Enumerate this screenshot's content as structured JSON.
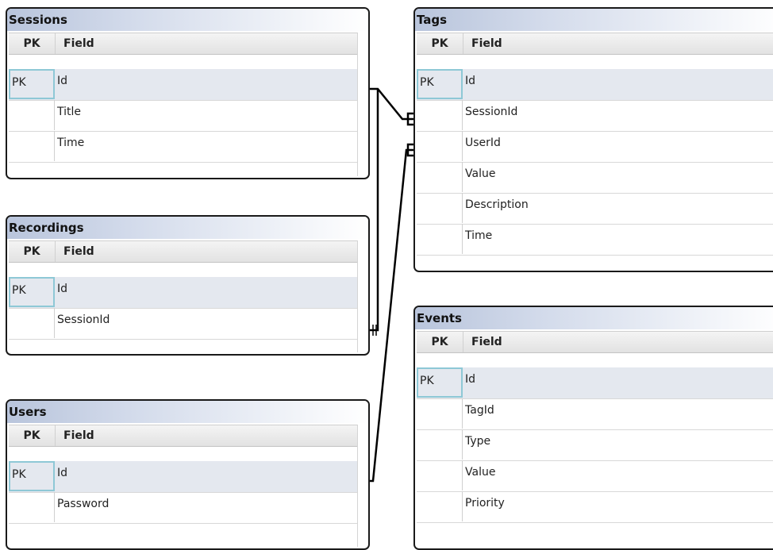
{
  "tables": {
    "sessions": {
      "name": "Sessions",
      "col_pk": "PK",
      "col_field": "Field",
      "rows": [
        {
          "pk": "PK",
          "field": "Id"
        },
        {
          "pk": "",
          "field": "Title"
        },
        {
          "pk": "",
          "field": "Time"
        }
      ]
    },
    "recordings": {
      "name": "Recordings",
      "col_pk": "PK",
      "col_field": "Field",
      "rows": [
        {
          "pk": "PK",
          "field": "Id"
        },
        {
          "pk": "",
          "field": "SessionId"
        }
      ]
    },
    "users": {
      "name": "Users",
      "col_pk": "PK",
      "col_field": "Field",
      "rows": [
        {
          "pk": "PK",
          "field": "Id"
        },
        {
          "pk": "",
          "field": "Password"
        }
      ]
    },
    "tags": {
      "name": "Tags",
      "col_pk": "PK",
      "col_field": "Field",
      "rows": [
        {
          "pk": "PK",
          "field": "Id"
        },
        {
          "pk": "",
          "field": "SessionId"
        },
        {
          "pk": "",
          "field": "UserId"
        },
        {
          "pk": "",
          "field": "Value"
        },
        {
          "pk": "",
          "field": "Description"
        },
        {
          "pk": "",
          "field": "Time"
        }
      ]
    },
    "events": {
      "name": "Events",
      "col_pk": "PK",
      "col_field": "Field",
      "rows": [
        {
          "pk": "PK",
          "field": "Id"
        },
        {
          "pk": "",
          "field": "TagId"
        },
        {
          "pk": "",
          "field": "Type"
        },
        {
          "pk": "",
          "field": "Value"
        },
        {
          "pk": "",
          "field": "Priority"
        }
      ]
    }
  },
  "relationships": [
    {
      "from": "Sessions",
      "to": "Tags"
    },
    {
      "from": "Sessions",
      "to": "Recordings"
    },
    {
      "from": "Users",
      "to": "Tags"
    }
  ]
}
